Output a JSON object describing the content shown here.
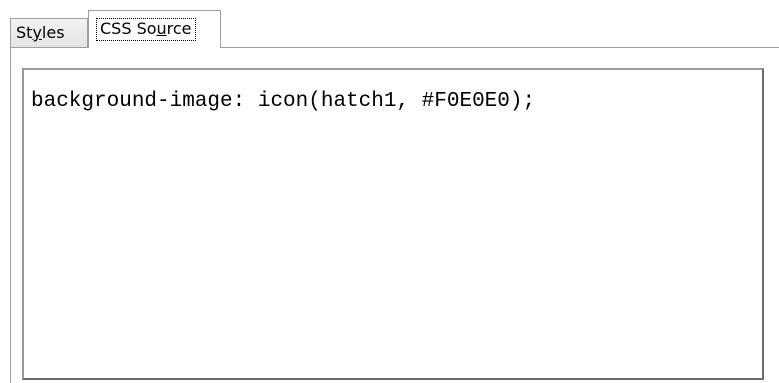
{
  "tabs": {
    "styles": {
      "before": "St",
      "mnemonic": "y",
      "after": "les"
    },
    "css_source": {
      "before": "CSS So",
      "mnemonic": "u",
      "after": "rce"
    }
  },
  "editor": {
    "content": "background-image: icon(hatch1, #F0E0E0);"
  }
}
